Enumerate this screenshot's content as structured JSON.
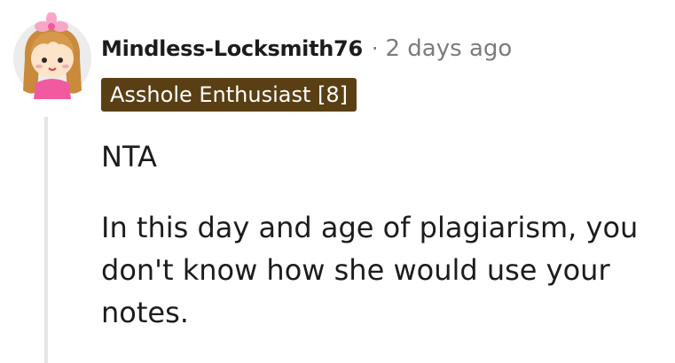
{
  "comment": {
    "author": "Mindless-Locksmith76",
    "separator": "·",
    "timestamp": "2 days ago",
    "flair": "Asshole Enthusiast [8]",
    "paragraphs": [
      "NTA",
      "In this day and age of plagiarism, you don't know how she would use your notes."
    ]
  },
  "colors": {
    "flair_background": "#5a3f14",
    "flair_text": "#ffffff",
    "muted_text": "#7c7c7c",
    "thread_line": "#e5e5e5"
  },
  "icons": {
    "avatar": "snoo-avatar-girl-with-pink-bow"
  }
}
